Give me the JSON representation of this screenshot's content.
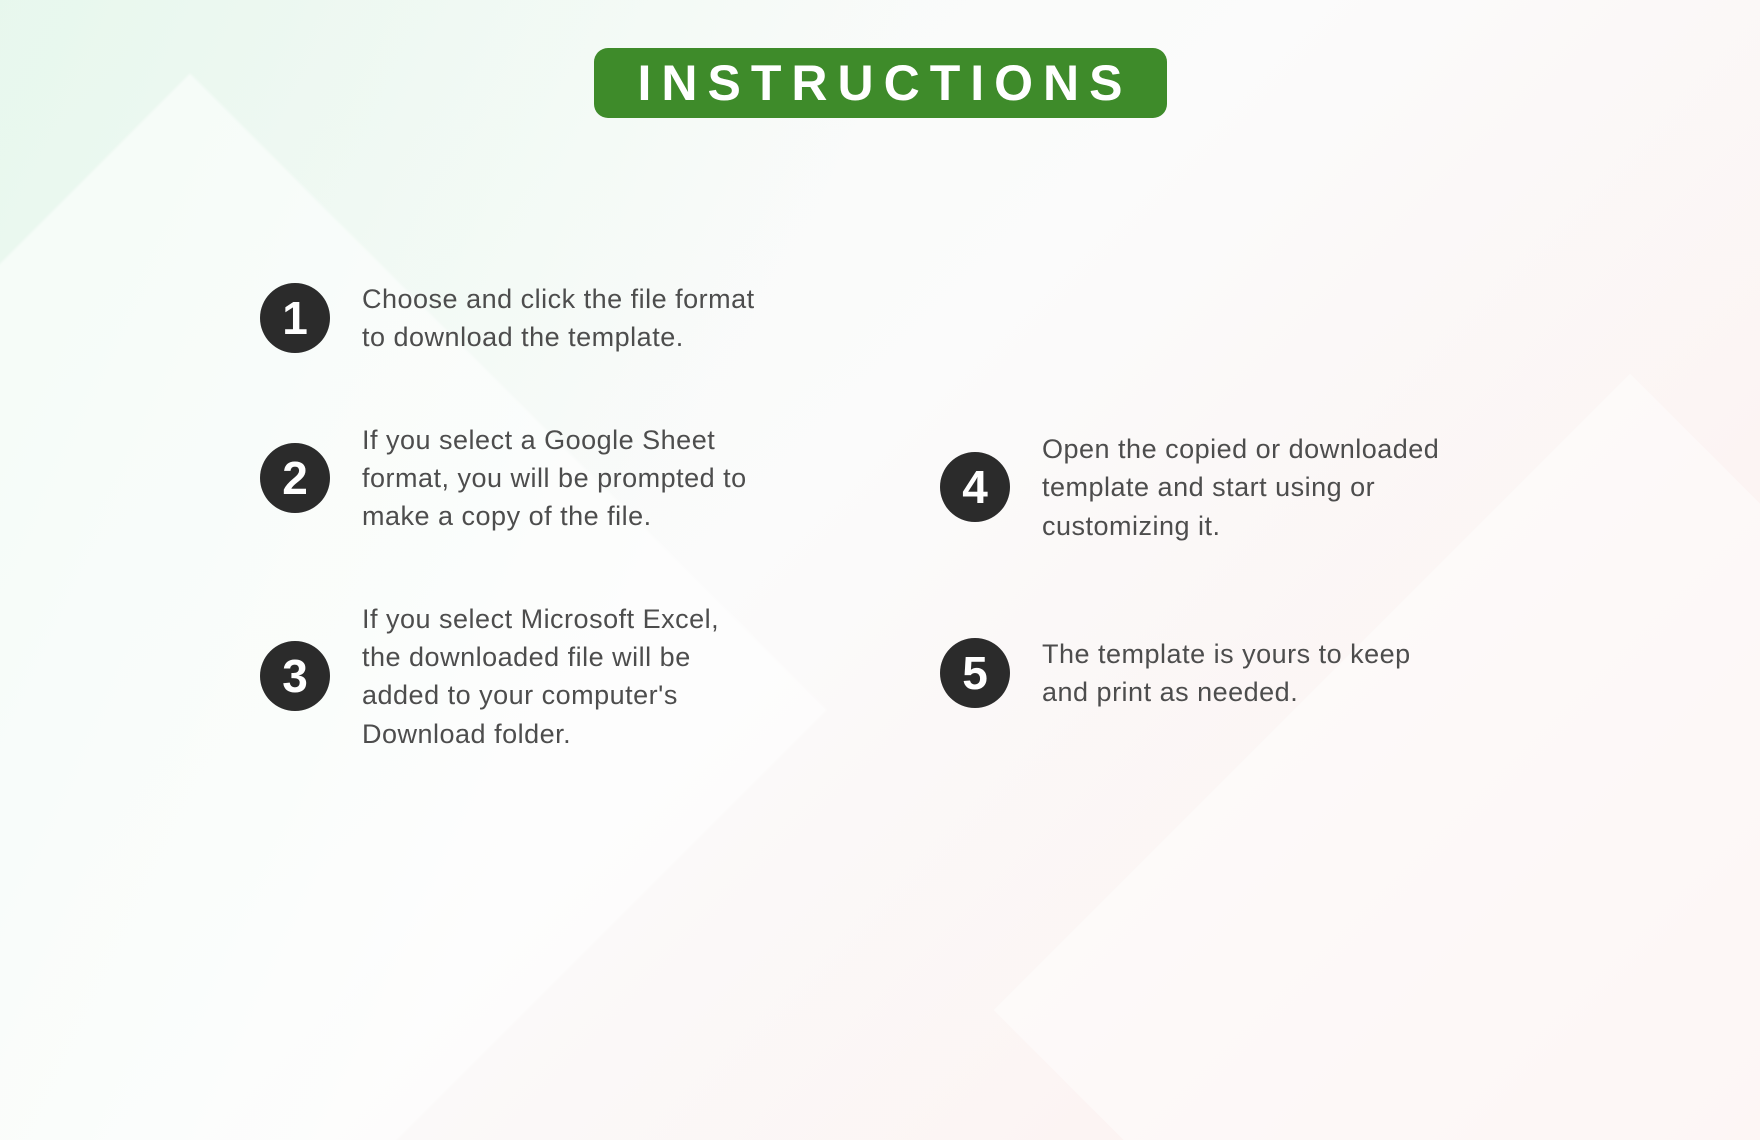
{
  "header": {
    "title": "INSTRUCTIONS"
  },
  "steps": [
    {
      "num": "1",
      "text": "Choose and click the file format to download the template."
    },
    {
      "num": "2",
      "text": "If you select a Google Sheet format, you will be prompted to make a copy of the file."
    },
    {
      "num": "3",
      "text": "If you select Microsoft Excel, the downloaded file will be added to your computer's Download  folder."
    },
    {
      "num": "4",
      "text": "Open the copied or downloaded template and start using or customizing it."
    },
    {
      "num": "5",
      "text": "The template is yours to keep and print as needed."
    }
  ],
  "colors": {
    "accent": "#3e8b2a",
    "badge": "#2b2b2b",
    "body_text": "#4d4d4d"
  }
}
